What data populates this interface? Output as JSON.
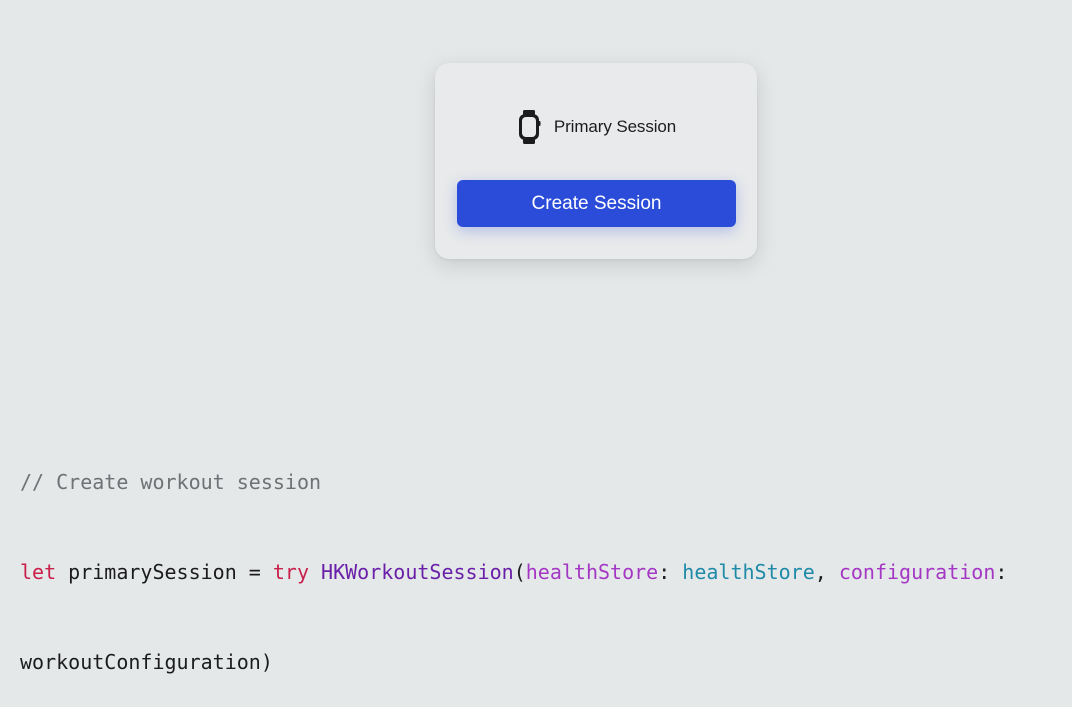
{
  "card": {
    "session_label": "Primary Session",
    "watch_icon": "apple-watch-icon",
    "create_button_label": "Create Session",
    "button_color": "#2b4cd8"
  },
  "code": {
    "comment": "// Create workout session",
    "line2": {
      "kw_let": "let",
      "var_name": " primarySession = ",
      "kw_try": "try",
      "space": " ",
      "type_name": "HKWorkoutSession",
      "open_paren": "(",
      "param1": "healthStore",
      "colon1": ": ",
      "arg1": "healthStore",
      "comma": ", ",
      "param2": "configuration",
      "colon2": ":"
    },
    "line3": {
      "arg2": "workoutConfiguration",
      "close_paren": ")"
    }
  },
  "colors": {
    "background": "#e5e8e9",
    "keyword": "#c8204b",
    "type": "#6a1fa8",
    "parameter": "#a437c4",
    "identifier": "#1f8aa8",
    "comment": "#6e7275"
  }
}
